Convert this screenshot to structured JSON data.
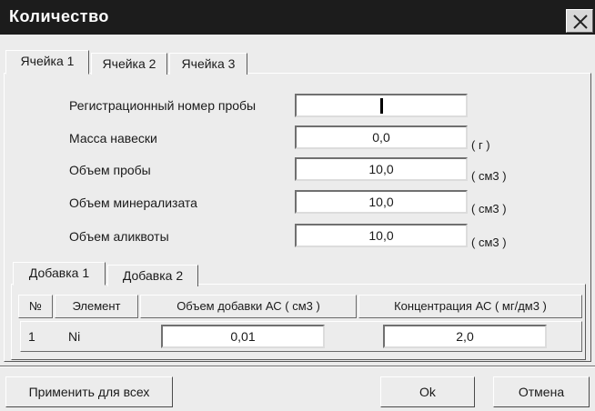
{
  "window": {
    "title": "Количество"
  },
  "tabs": [
    "Ячейка 1",
    "Ячейка 2",
    "Ячейка 3"
  ],
  "form": {
    "reg_number": {
      "label": "Регистрационный номер пробы",
      "value": ""
    },
    "mass": {
      "label": "Масса навески",
      "value": "0,0",
      "unit": "( г )"
    },
    "sample_volume": {
      "label": "Объем пробы",
      "value": "10,0",
      "unit": "( см3 )"
    },
    "mineralizate_volume": {
      "label": "Объем минерализата",
      "value": "10,0",
      "unit": "( см3 )"
    },
    "aliquot_volume": {
      "label": "Объем аликвоты",
      "value": "10,0",
      "unit": "( см3 )"
    }
  },
  "additive_tabs": [
    "Добавка 1",
    "Добавка 2"
  ],
  "additive_table": {
    "headers": [
      "№",
      "Элемент",
      "Объем добавки АС ( см3 )",
      "Концентрация АС ( мг/дм3 )"
    ],
    "rows": [
      {
        "num": "1",
        "element": "Ni",
        "volume": "0,01",
        "concentration": "2,0"
      }
    ]
  },
  "buttons": {
    "apply_all": "Применить для всех",
    "ok": "Ok",
    "cancel": "Отмена"
  }
}
